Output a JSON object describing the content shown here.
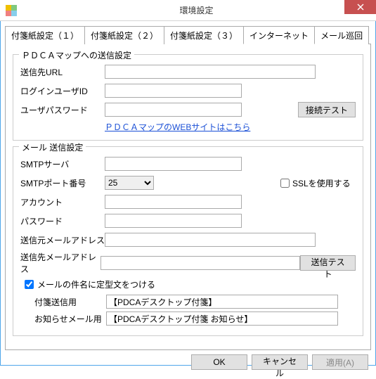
{
  "window": {
    "title": "環境設定"
  },
  "tabs": {
    "t1": "付箋紙設定（１）",
    "t2": "付箋紙設定（２）",
    "t3": "付箋紙設定（３）",
    "t4": "インターネット",
    "t5": "メール巡回"
  },
  "pdca_group": {
    "legend": "ＰＤＣＡマップへの送信設定",
    "url_label": "送信先URL",
    "url_value": "",
    "user_label": "ログインユーザID",
    "user_value": "",
    "pass_label": "ユーザパスワード",
    "pass_value": "",
    "test_btn": "接続テスト",
    "link_text": "ＰＤＣＡマップのWEBサイトはこちら"
  },
  "mail_group": {
    "legend": "メール 送信設定",
    "smtp_label": "SMTPサーバ",
    "smtp_value": "",
    "port_label": "SMTPポート番号",
    "port_value": "25",
    "ssl_label": "SSLを使用する",
    "account_label": "アカウント",
    "account_value": "",
    "pass_label": "パスワード",
    "pass_value": "",
    "from_label": "送信元メールアドレス",
    "from_value": "",
    "to_label": "送信先メールアドレス",
    "to_value": "",
    "send_test_btn": "送信テスト",
    "subject_checkbox": "メールの件名に定型文をつける",
    "prefix1_label": "付箋送信用",
    "prefix1_value": "【PDCAデスクトップ付箋】",
    "prefix2_label": "お知らせメール用",
    "prefix2_value": "【PDCAデスクトップ付箋 お知らせ】"
  },
  "buttons": {
    "ok": "OK",
    "cancel": "キャンセル",
    "apply": "適用(A)"
  }
}
